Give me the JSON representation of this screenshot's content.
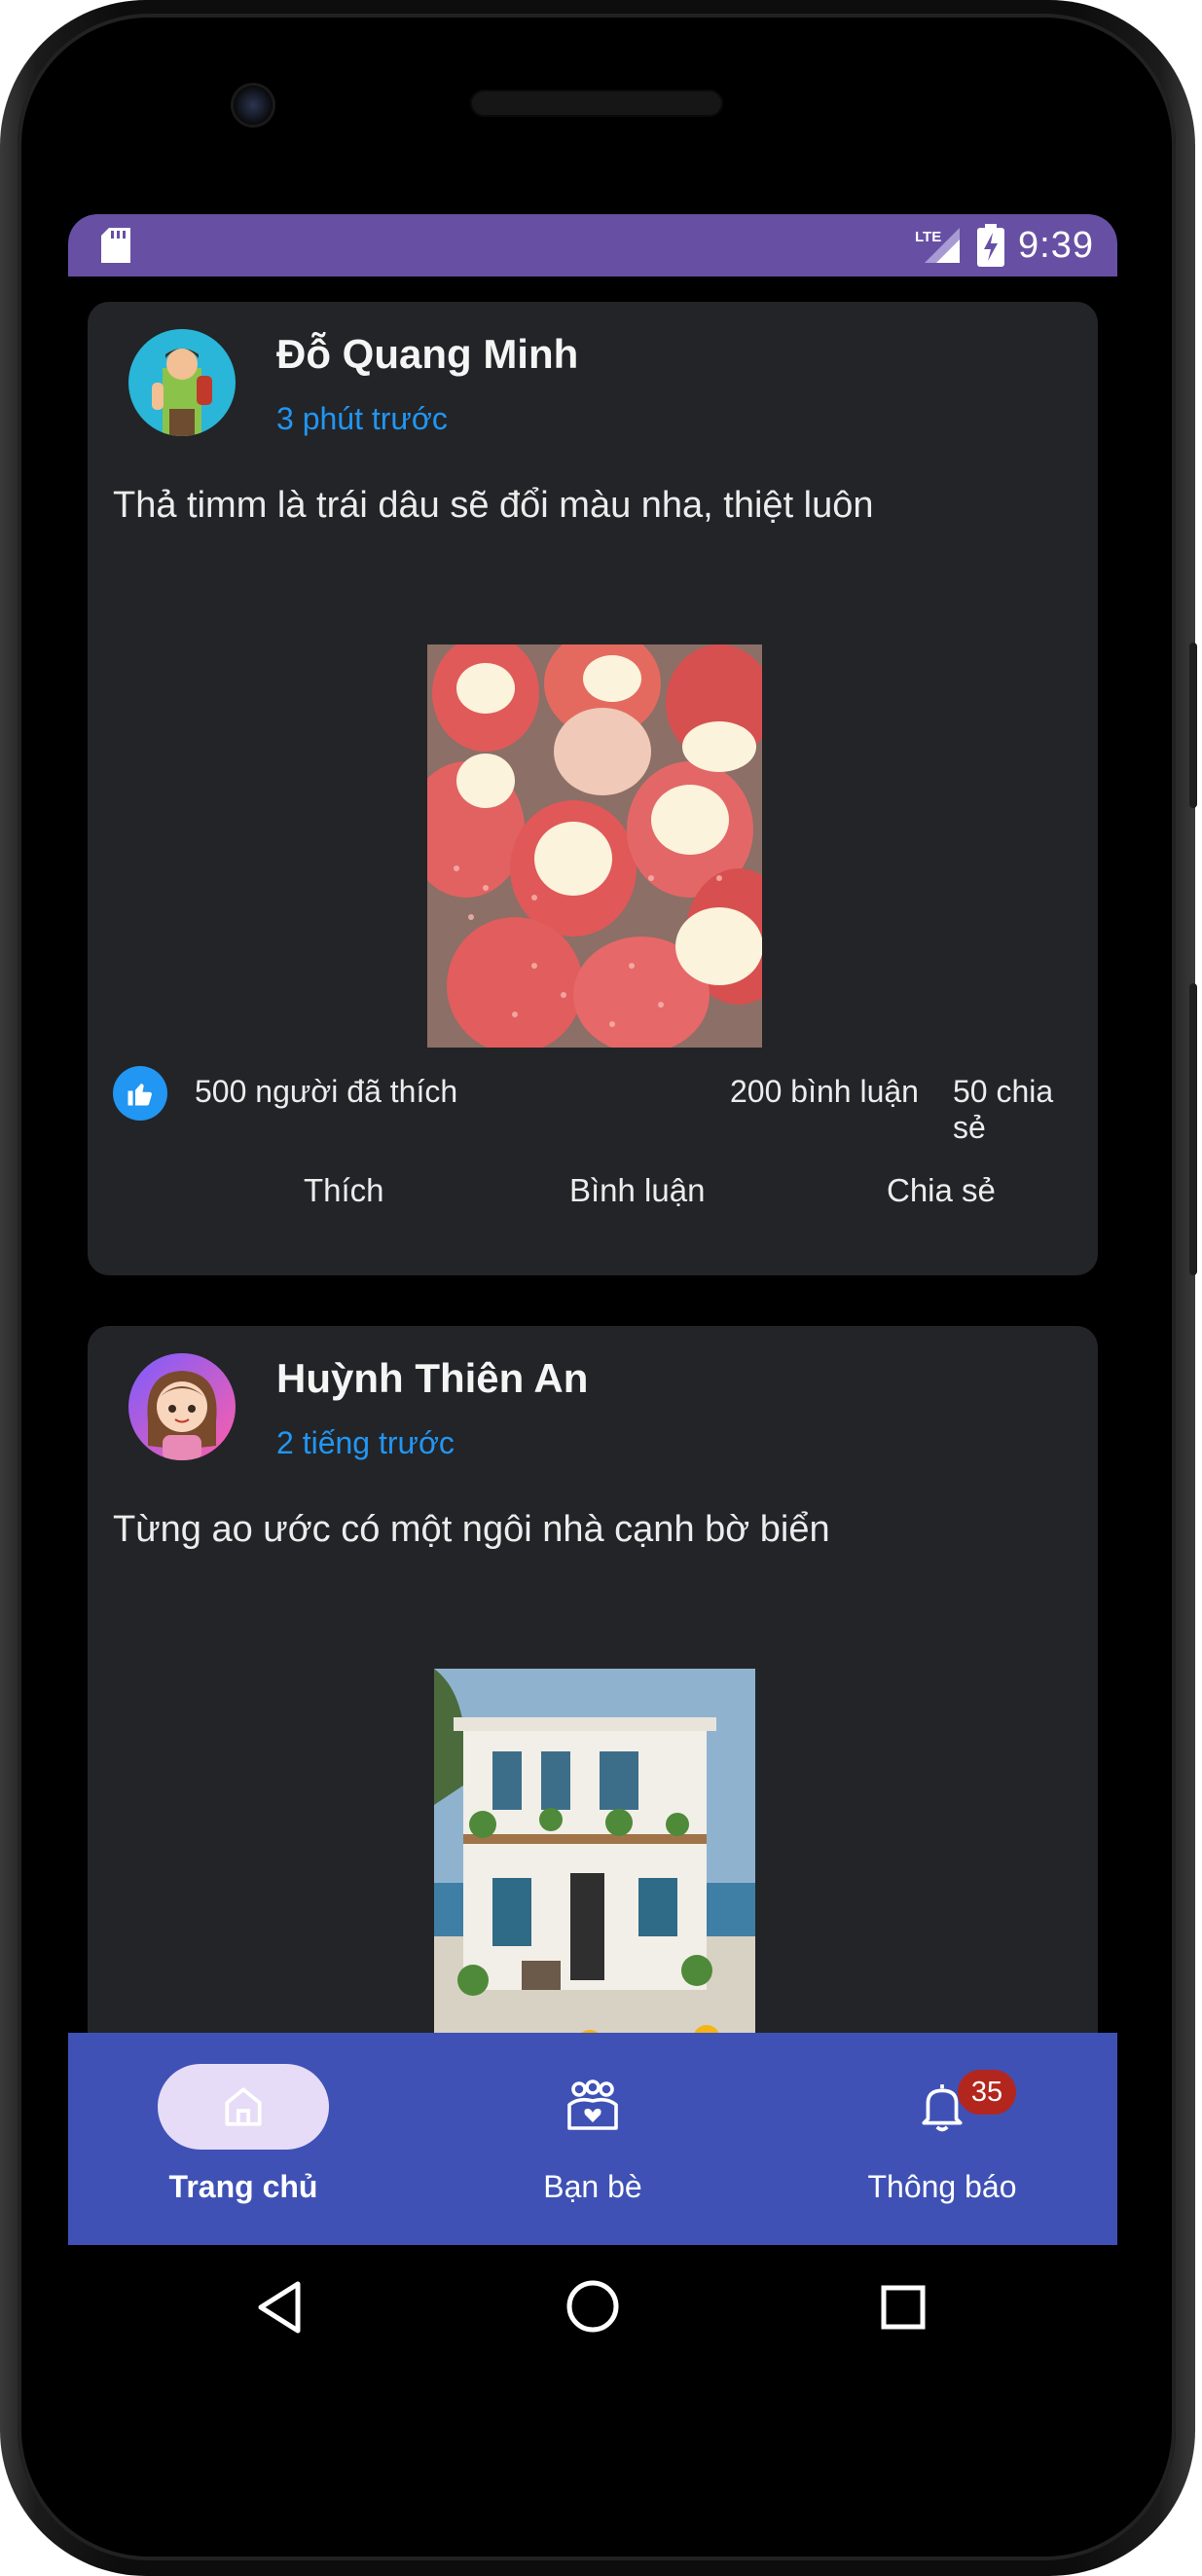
{
  "status_bar": {
    "network": "LTE",
    "time": "9:39"
  },
  "posts": [
    {
      "author": "Đỗ Quang Minh",
      "time": "3 phút trước",
      "content": "Thả timm là trái dâu sẽ đổi màu nha, thiệt luôn",
      "image": "strawberries-with-cream",
      "likes_text": "500 người đã thích",
      "comments_text": "200 bình luận",
      "shares_text": "50 chia sẻ",
      "actions": {
        "like": "Thích",
        "comment": "Bình luận",
        "share": "Chia sẻ"
      }
    },
    {
      "author": "Huỳnh Thiên An",
      "time": "2 tiếng trước",
      "content": "Từng ao ước có một ngôi nhà cạnh bờ biển",
      "image": "house-by-the-sea"
    }
  ],
  "bottom_nav": {
    "items": [
      {
        "label": "Trang chủ",
        "icon": "home-icon",
        "active": true
      },
      {
        "label": "Bạn bè",
        "icon": "friends-icon",
        "active": false
      },
      {
        "label": "Thông báo",
        "icon": "bell-icon",
        "active": false,
        "badge": "35"
      }
    ]
  },
  "colors": {
    "status_bar": "#6750a4",
    "card": "#232427",
    "accent_blue": "#2196f3",
    "bottom_nav": "#3f51b5",
    "active_pill": "#e6dcf7",
    "badge": "#b3261e"
  }
}
